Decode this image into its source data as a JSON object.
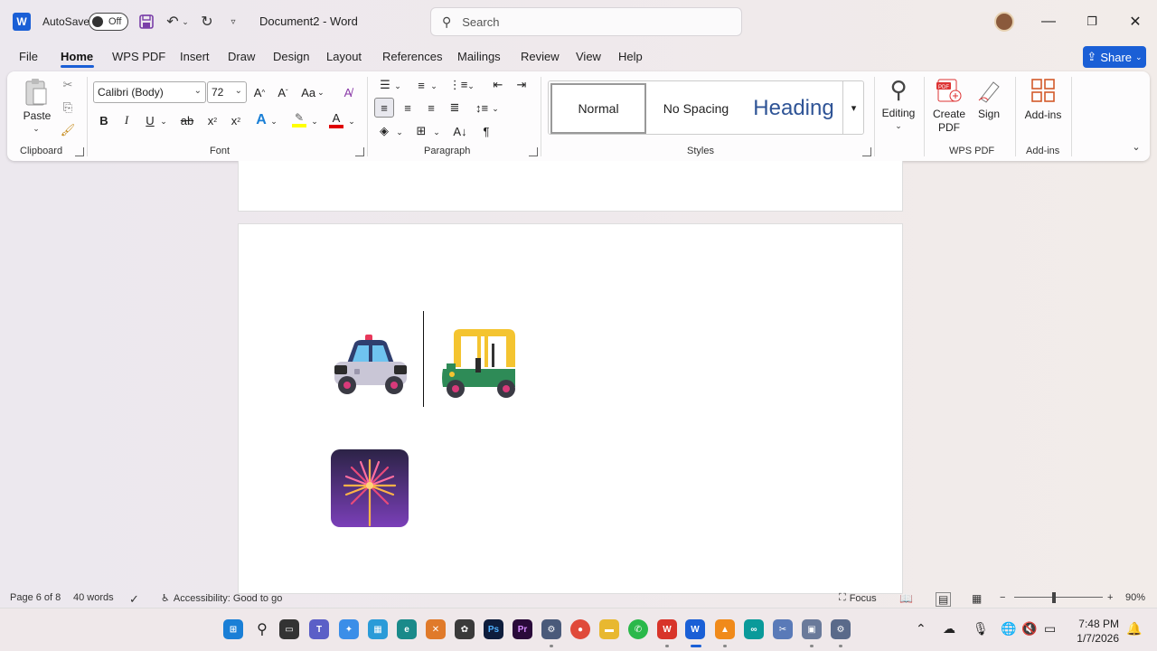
{
  "titlebar": {
    "app_logo": "W",
    "autosave_label": "AutoSave",
    "autosave_state": "Off",
    "document_title": "Document2  -  Word",
    "search_placeholder": "Search"
  },
  "tabs": [
    "File",
    "Home",
    "WPS PDF",
    "Insert",
    "Draw",
    "Design",
    "Layout",
    "References",
    "Mailings",
    "Review",
    "View",
    "Help"
  ],
  "active_tab": "Home",
  "share_label": "Share",
  "ribbon": {
    "clipboard": {
      "paste_label": "Paste",
      "group_label": "Clipboard"
    },
    "font": {
      "font_name": "Calibri (Body)",
      "font_size": "72",
      "case_label": "Aa",
      "group_label": "Font"
    },
    "paragraph": {
      "group_label": "Paragraph"
    },
    "styles": {
      "normal": "Normal",
      "no_spacing": "No Spacing",
      "heading": "Heading",
      "group_label": "Styles"
    },
    "editing": {
      "label": "Editing"
    },
    "wps_pdf": {
      "create_label": "Create PDF",
      "sign_label": "Sign",
      "group_label": "WPS PDF"
    },
    "addins": {
      "label": "Add-ins",
      "group_label": "Add-ins"
    }
  },
  "document": {
    "emojis": [
      "police-car",
      "auto-rickshaw",
      "fireworks"
    ]
  },
  "status": {
    "page": "Page 6 of 8",
    "words": "40 words",
    "accessibility": "Accessibility: Good to go",
    "focus": "Focus",
    "zoom": "90%",
    "zoom_level": 0.9
  },
  "taskbar": {
    "time": "7:48 PM",
    "date": "1/7/2026"
  },
  "colors": {
    "accent": "#1a5fd6",
    "heading_style": "#2f5496",
    "highlight": "#ffff00",
    "font_color": "#e00000"
  }
}
